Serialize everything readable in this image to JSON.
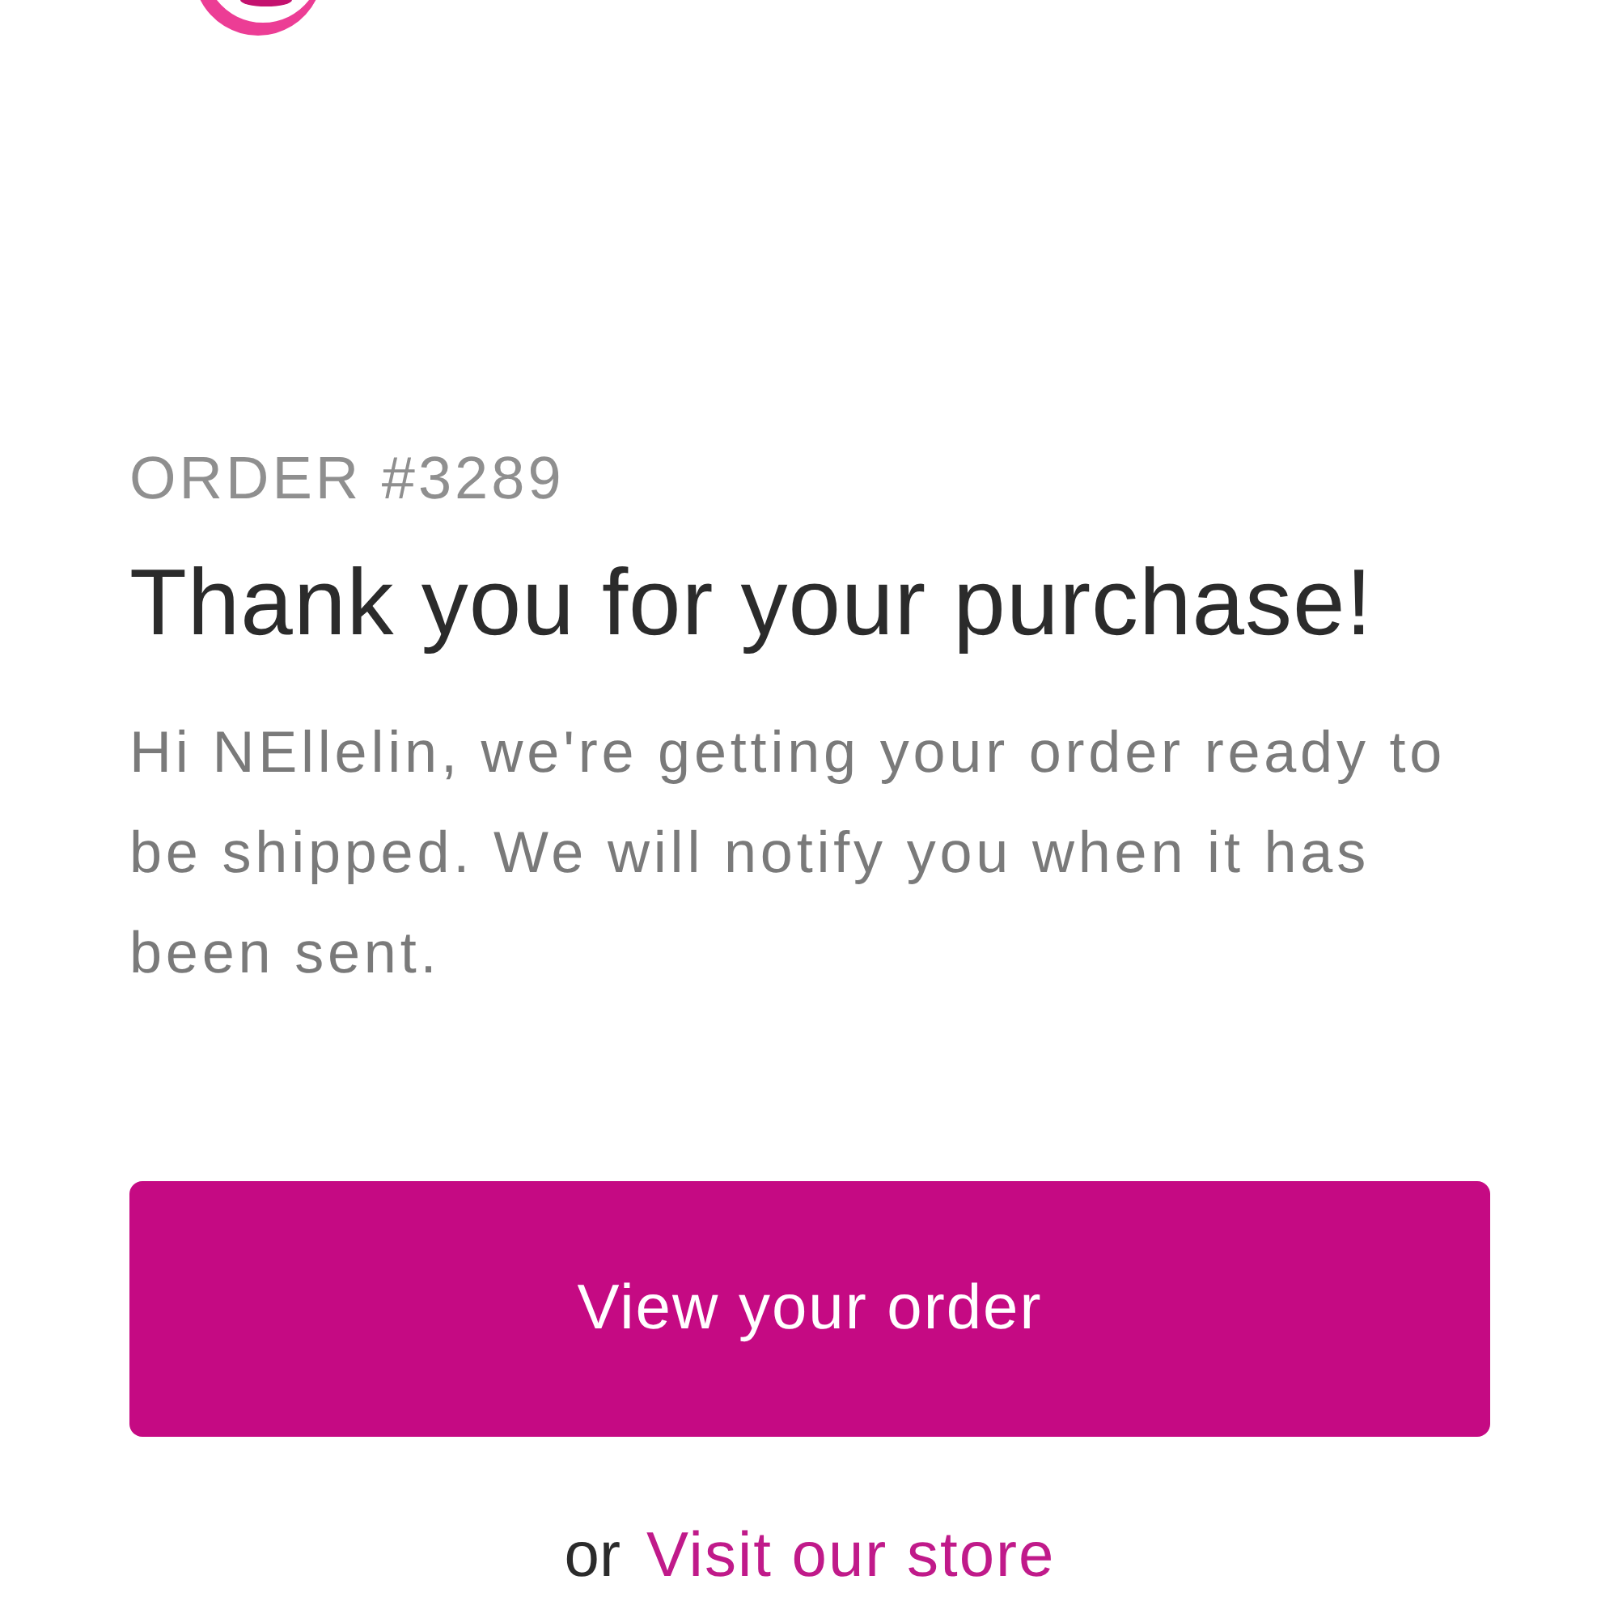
{
  "order_number": "ORDER #3289",
  "heading": "Thank you for your purchase!",
  "message": "Hi NEllelin, we're getting your order ready to be shipped. We will notify you when it has been sent.",
  "primary_button": {
    "label": "View your order"
  },
  "secondary_link": {
    "prefix": "or",
    "label": "Visit our store"
  }
}
